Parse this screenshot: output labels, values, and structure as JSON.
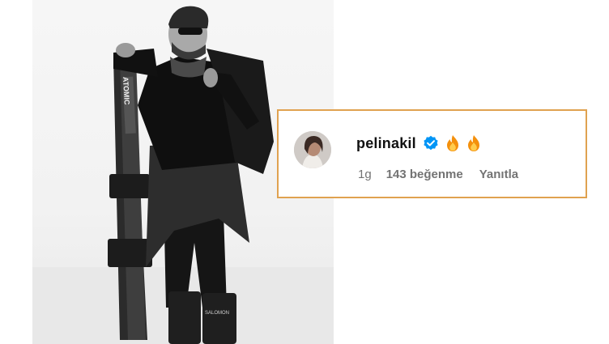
{
  "comment": {
    "username": "pelinakil",
    "verified_icon": "verified-badge-icon",
    "emoji_icons": [
      "fire-icon",
      "fire-icon"
    ],
    "time": "1g",
    "likes": "143 beğenme",
    "reply": "Yanıtla"
  },
  "photo": {
    "ski_brand": "ATOMIC",
    "boot_brand": "SALOMON"
  },
  "colors": {
    "highlight_border": "#e0a250",
    "verified_blue": "#0095f6",
    "meta_gray": "#737373"
  }
}
